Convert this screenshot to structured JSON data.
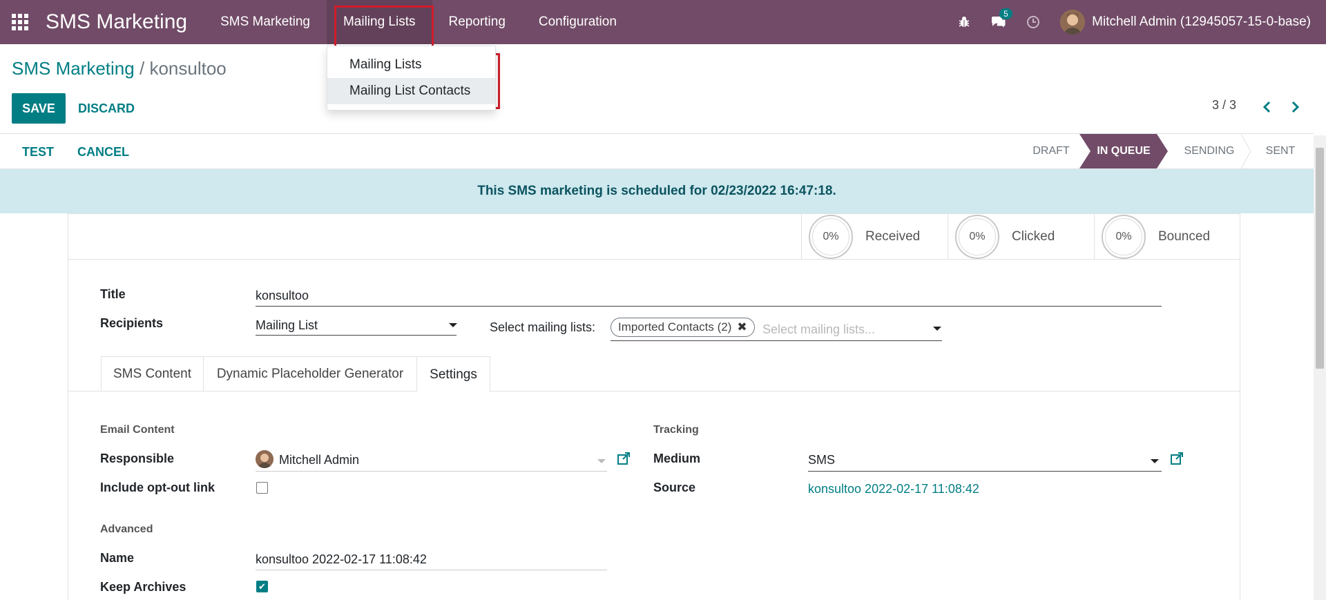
{
  "navbar": {
    "brand": "SMS Marketing",
    "menu": [
      "SMS Marketing",
      "Mailing Lists",
      "Reporting",
      "Configuration"
    ],
    "messages_badge": "5",
    "user": "Mitchell Admin (12945057-15-0-base)"
  },
  "dropdown": {
    "items": [
      "Mailing Lists",
      "Mailing List Contacts"
    ]
  },
  "breadcrumb": {
    "parent": "SMS Marketing",
    "separator": "/",
    "current": "konsultoo"
  },
  "actions": {
    "save": "SAVE",
    "discard": "DISCARD",
    "pager": "3 / 3",
    "test": "TEST",
    "cancel": "CANCEL"
  },
  "stages": [
    "DRAFT",
    "IN QUEUE",
    "SENDING",
    "SENT"
  ],
  "alert": "This SMS marketing is scheduled for 02/23/2022 16:47:18.",
  "stats": [
    {
      "pct": "0%",
      "label": "Received"
    },
    {
      "pct": "0%",
      "label": "Clicked"
    },
    {
      "pct": "0%",
      "label": "Bounced"
    }
  ],
  "form": {
    "title_label": "Title",
    "title_value": "konsultoo",
    "recipients_label": "Recipients",
    "recipients_value": "Mailing List",
    "select_lists_label": "Select mailing lists:",
    "tag": "Imported Contacts (2)",
    "lists_placeholder": "Select mailing lists..."
  },
  "tabs": [
    "SMS Content",
    "Dynamic Placeholder Generator",
    "Settings"
  ],
  "settings": {
    "email_content_title": "Email Content",
    "responsible_label": "Responsible",
    "responsible_value": "Mitchell Admin",
    "optout_label": "Include opt-out link",
    "tracking_title": "Tracking",
    "medium_label": "Medium",
    "medium_value": "SMS",
    "source_label": "Source",
    "source_value": "konsultoo 2022-02-17 11:08:42",
    "advanced_title": "Advanced",
    "name_label": "Name",
    "name_value": "konsultoo 2022-02-17 11:08:42",
    "keep_archives_label": "Keep Archives"
  },
  "colors": {
    "brand": "#714B67",
    "accent": "#017E84",
    "alert_bg": "#cfe9ee",
    "highlight": "#d11c2b"
  }
}
